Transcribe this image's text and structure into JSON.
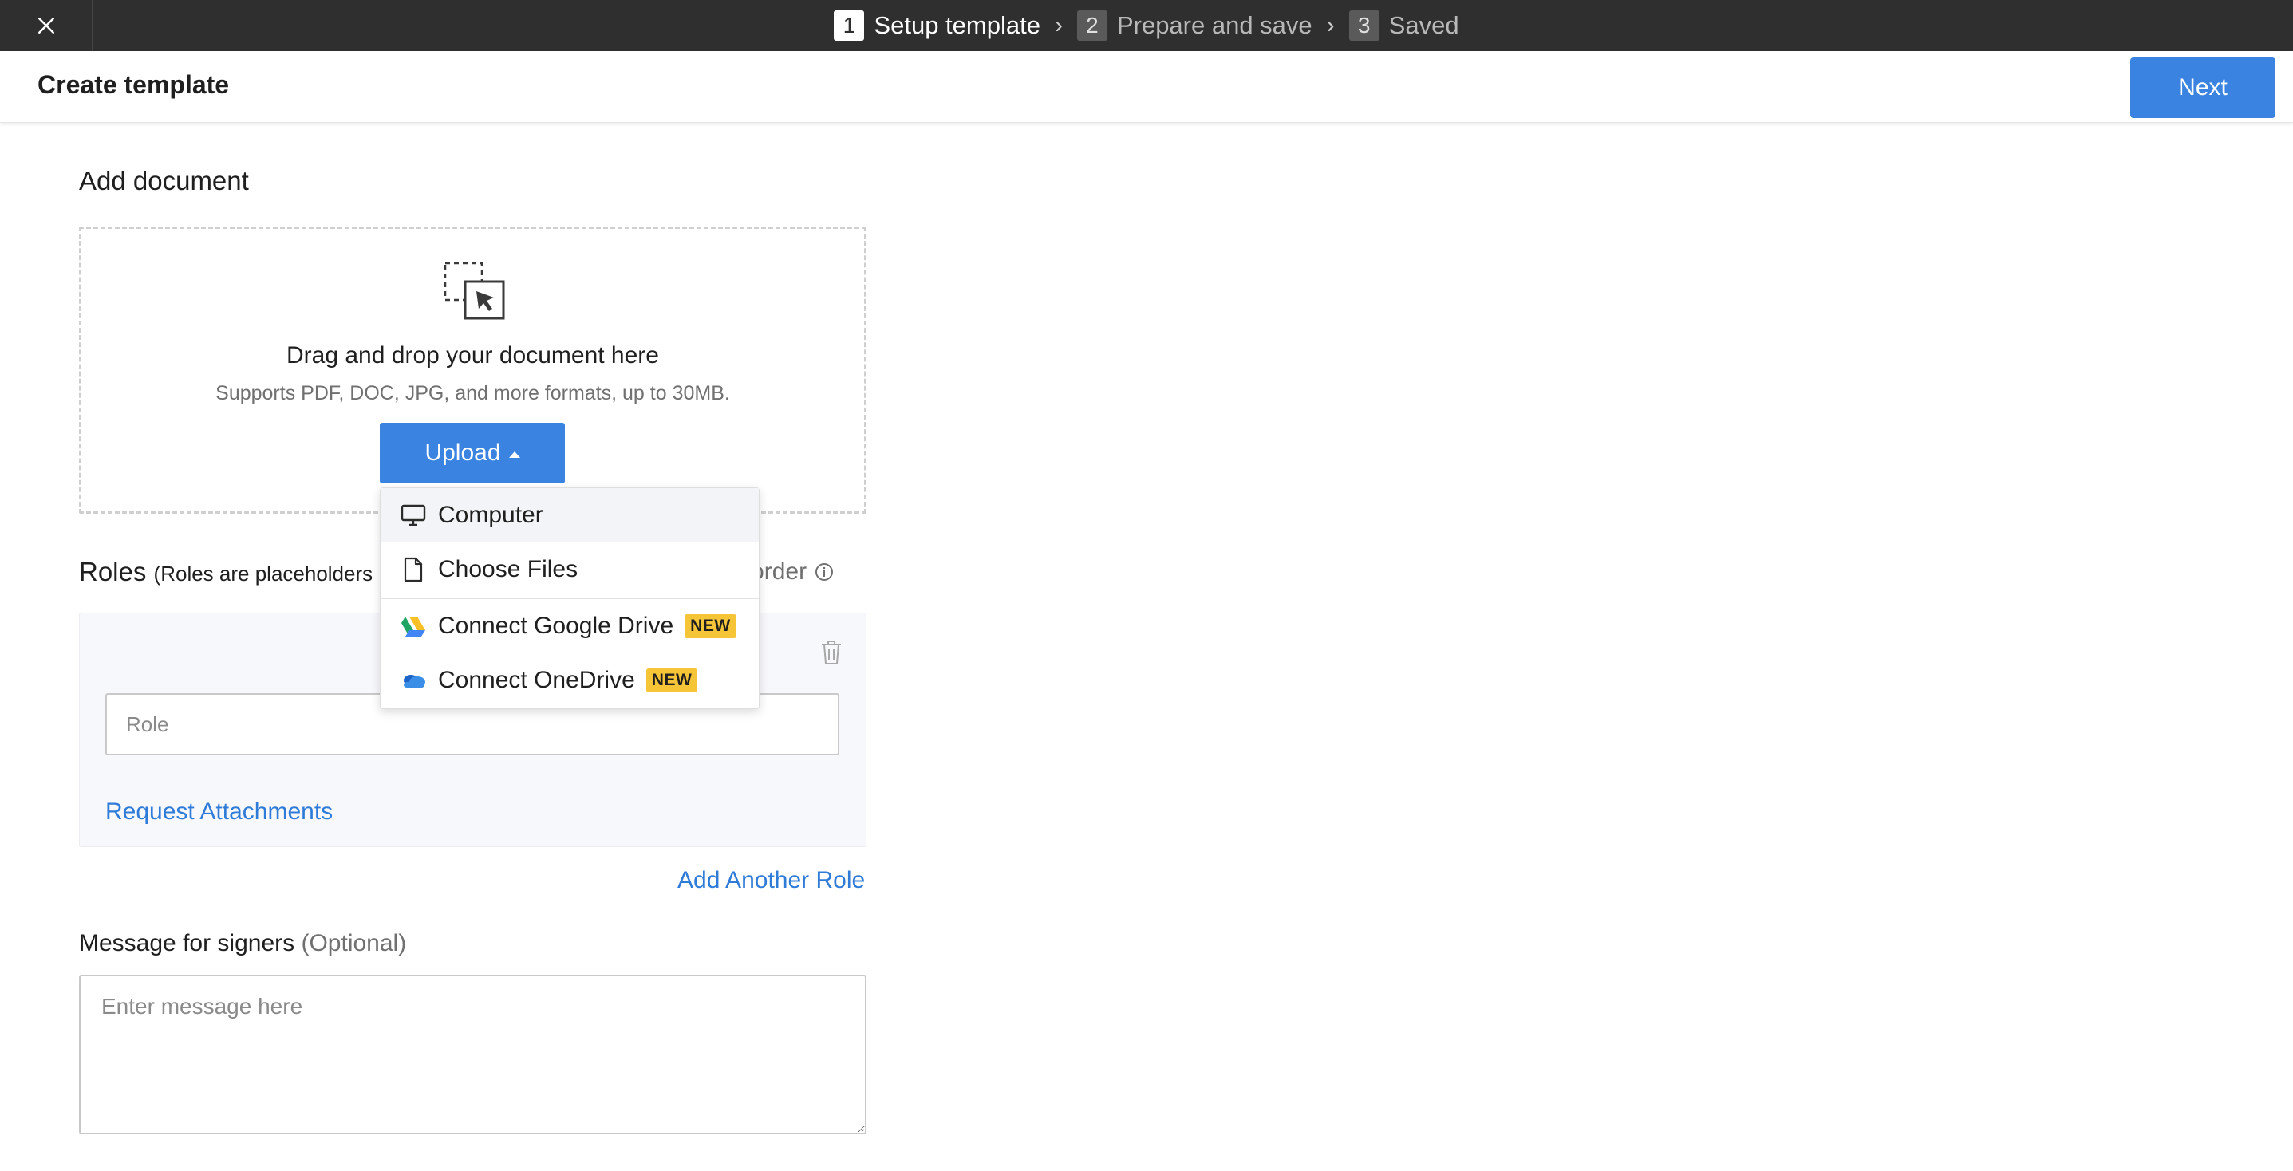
{
  "stepper": {
    "steps": [
      {
        "num": "1",
        "label": "Setup template"
      },
      {
        "num": "2",
        "label": "Prepare and save"
      },
      {
        "num": "3",
        "label": "Saved"
      }
    ],
    "active_step": 1
  },
  "header": {
    "title": "Create template",
    "next_label": "Next"
  },
  "add_document": {
    "title": "Add document",
    "drop_title": "Drag and drop your document here",
    "drop_subtitle": "Supports PDF, DOC, JPG, and more formats, up to 30MB.",
    "upload_label": "Upload"
  },
  "upload_menu": {
    "items": [
      {
        "label": "Computer",
        "icon": "monitor-icon"
      },
      {
        "label": "Choose Files",
        "icon": "file-icon"
      },
      {
        "label": "Connect Google Drive",
        "icon": "google-drive-icon",
        "badge": "NEW"
      },
      {
        "label": "Connect OneDrive",
        "icon": "onedrive-icon",
        "badge": "NEW"
      }
    ]
  },
  "roles": {
    "title": "Roles",
    "hint": "(Roles are placeholders",
    "signing_order_label": "g order",
    "role_placeholder": "Role",
    "request_attachments_label": "Request Attachments",
    "add_another_role_label": "Add Another Role"
  },
  "message": {
    "title": "Message for signers",
    "optional": "(Optional)",
    "placeholder": "Enter message here"
  },
  "colors": {
    "primary": "#3b83e0",
    "link": "#2f7bd8",
    "topbar": "#2f2f2f",
    "badge": "#f5c437"
  }
}
